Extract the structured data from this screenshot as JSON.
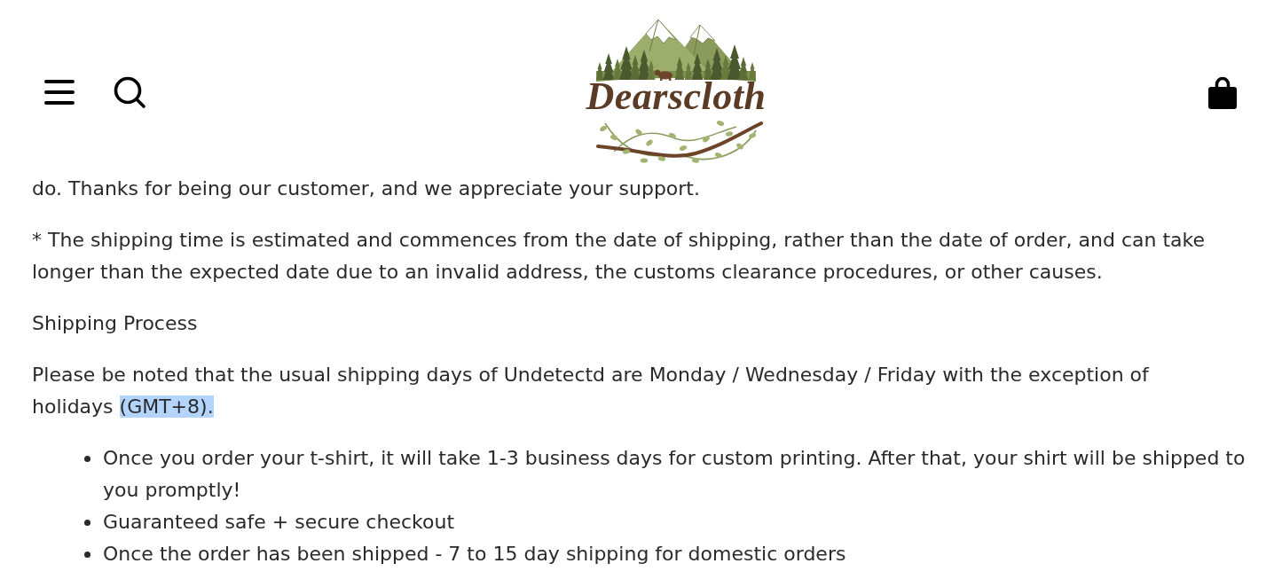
{
  "header": {
    "logo": {
      "text": "Dearscloth"
    }
  },
  "content": [
    {
      "kind": "paragraph",
      "segments": [
        {
          "text": "do. Thanks for being our customer, and we appreciate your support.",
          "selected": false
        }
      ]
    },
    {
      "kind": "paragraph",
      "segments": [
        {
          "text": "* The shipping time is estimated and commences from the date of shipping, rather than the date of order, and can take longer than the expected date due to an invalid address, the customs clearance procedures, or other causes.",
          "selected": false
        }
      ]
    },
    {
      "kind": "paragraph",
      "segments": [
        {
          "text": "Shipping Process",
          "selected": false
        }
      ]
    },
    {
      "kind": "paragraph",
      "segments": [
        {
          "text": "Please be noted that the usual shipping days of Undetectd are Monday / Wednesday / Friday with the exception of holidays ",
          "selected": false
        },
        {
          "text": "(GMT+8).",
          "selected": true
        }
      ]
    },
    {
      "kind": "list",
      "items": [
        "Once you order your t-shirt, it will take 1-3 business days for custom printing. After that, your shirt will be shipped to you promptly!",
        "Guaranteed safe + secure checkout",
        "Once the order has been shipped - 7 to 15 day shipping for domestic orders"
      ]
    }
  ]
}
